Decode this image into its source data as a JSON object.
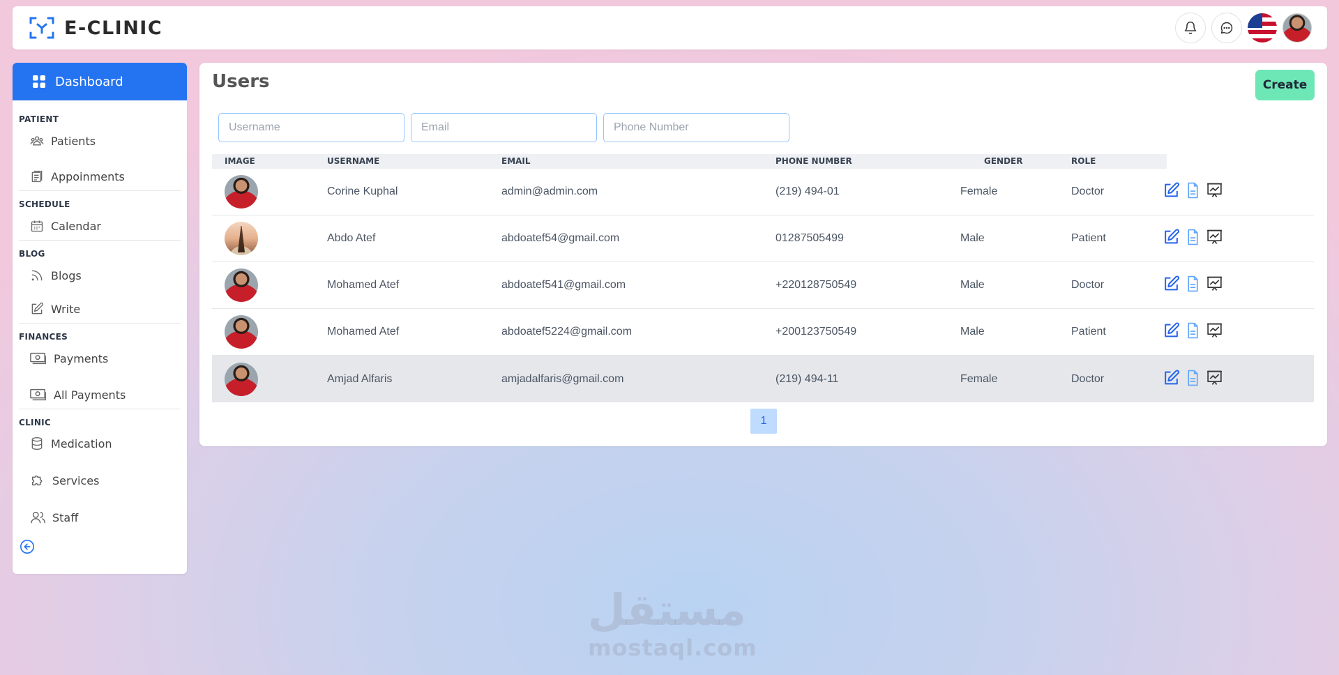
{
  "header": {
    "brand": "E-CLINIC",
    "icons": [
      "bell-icon",
      "chat-icon",
      "us-flag",
      "user-avatar"
    ]
  },
  "sidebar": {
    "dashboard": "Dashboard",
    "sections": {
      "patient": "PATIENT",
      "schedule": "SCHEDULE",
      "blog": "BLOG",
      "finances": "FINANCES",
      "clinic": "CLINIC"
    },
    "items": {
      "patients": "Patients",
      "appointments": "Appoinments",
      "calendar": "Calendar",
      "blogs": "Blogs",
      "write": "Write",
      "payments": "Payments",
      "all_payments": "All Payments",
      "medication": "Medication",
      "services": "Services",
      "staff": "Staff"
    }
  },
  "main": {
    "title": "Users",
    "create_label": "Create",
    "filters": {
      "username_placeholder": "Username",
      "email_placeholder": "Email",
      "phone_placeholder": "Phone Number"
    },
    "columns": {
      "image": "IMAGE",
      "username": "USERNAME",
      "email": "EMAIL",
      "phone": "PHONE NUMBER",
      "gender": "GENDER",
      "role": "ROLE"
    },
    "rows": [
      {
        "username": "Corine Kuphal",
        "email": "admin@admin.com",
        "phone": "(219) 494-01",
        "gender": "Female",
        "role": "Doctor"
      },
      {
        "username": "Abdo Atef",
        "email": "abdoatef54@gmail.com",
        "phone": "01287505499",
        "gender": "Male",
        "role": "Patient"
      },
      {
        "username": "Mohamed Atef",
        "email": "abdoatef541@gmail.com",
        "phone": "+220128750549",
        "gender": "Male",
        "role": "Doctor"
      },
      {
        "username": "Mohamed Atef",
        "email": "abdoatef5224@gmail.com",
        "phone": "+200123750549",
        "gender": "Male",
        "role": "Patient"
      },
      {
        "username": "Amjad Alfaris",
        "email": "amjadalfaris@gmail.com",
        "phone": "(219) 494-11",
        "gender": "Female",
        "role": "Doctor"
      }
    ],
    "pagination": {
      "current": "1"
    }
  },
  "watermark": {
    "arabic": "مستقل",
    "latin": "mostaql.com"
  },
  "colors": {
    "primary": "#2474f2",
    "create": "#6ee7b7",
    "icon_blue": "#2563eb"
  }
}
